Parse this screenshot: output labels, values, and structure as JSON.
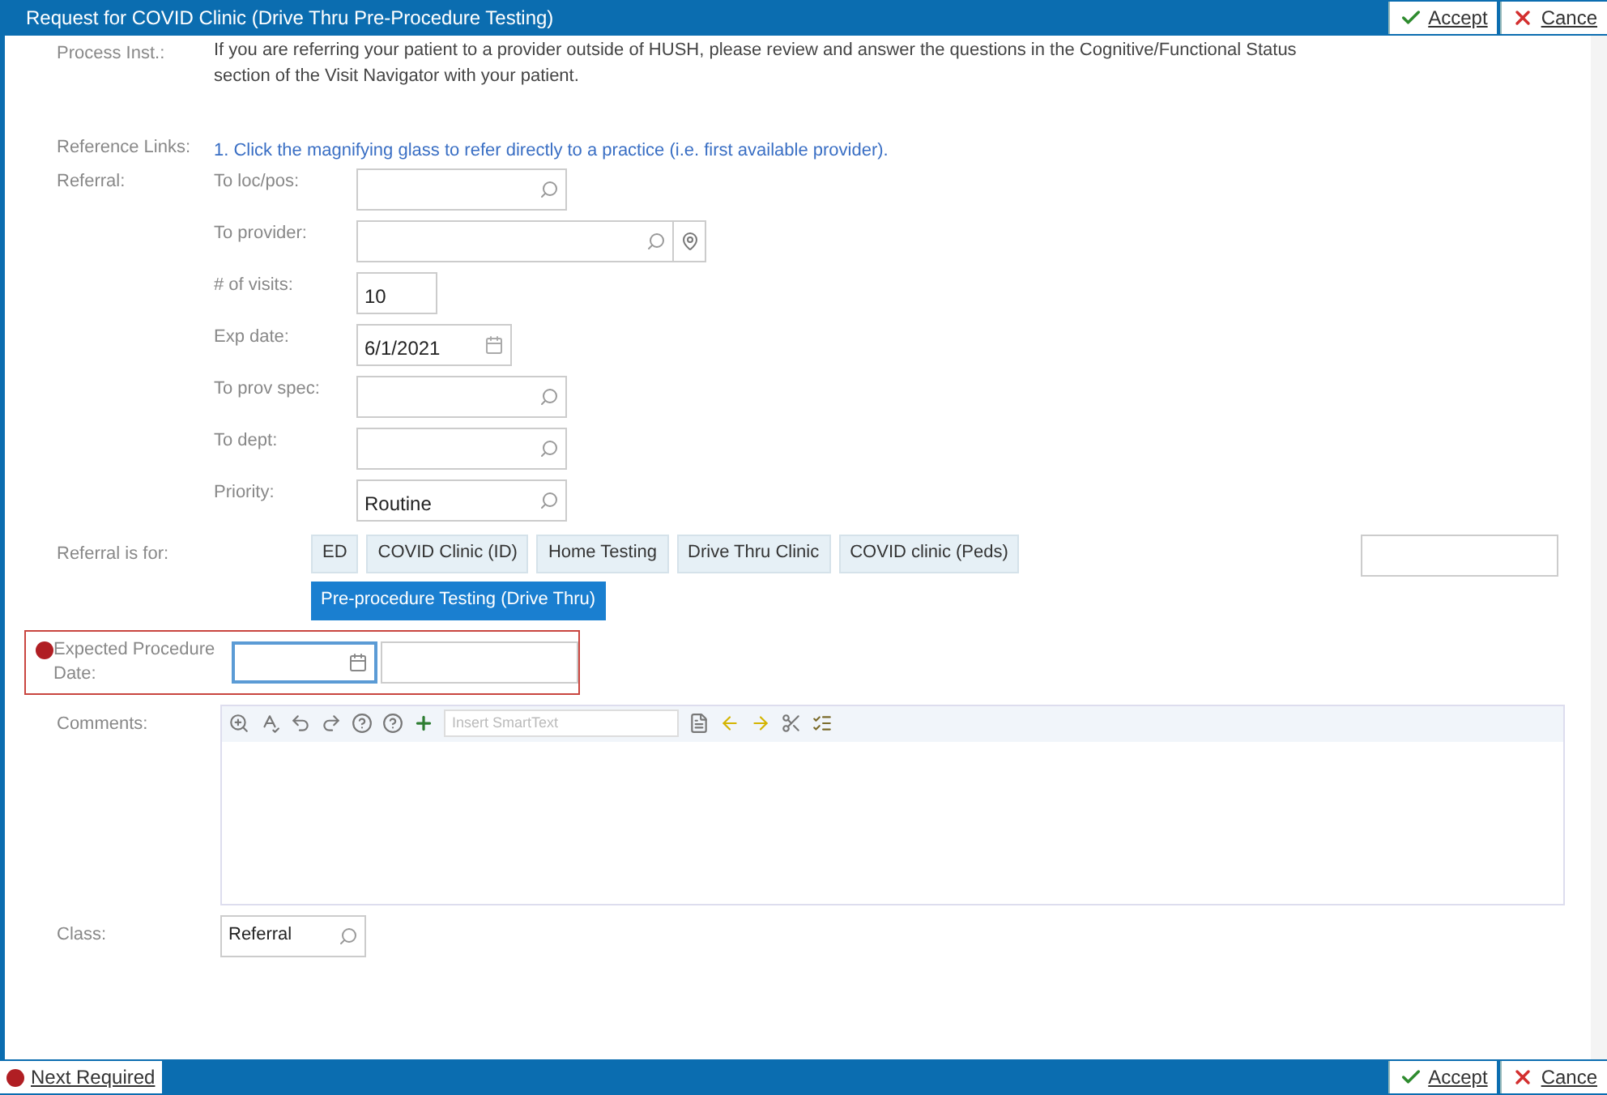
{
  "title": "Request for COVID Clinic (Drive Thru Pre-Procedure Testing)",
  "header_buttons": [
    {
      "kind": "accept",
      "label": "Accept"
    },
    {
      "kind": "cancel",
      "label": "Cance"
    }
  ],
  "process_inst": {
    "label": "Process Inst.:",
    "lines": [
      "If you are referring your patient to a provider outside of HUSH, please review and answer the questions in the Cognitive/Functional Status",
      "section of the Visit Navigator with your patient."
    ]
  },
  "reference_links": {
    "label": "Reference Links:",
    "link": "1. Click the magnifying glass to refer directly to a practice (i.e. first available provider)."
  },
  "referral": {
    "label": "Referral:",
    "fields": [
      {
        "label": "To loc/pos:",
        "kind": "lookup"
      },
      {
        "label": "To provider:",
        "kind": "lookup_pin"
      },
      {
        "label": "# of visits:",
        "kind": "text",
        "value": "10"
      },
      {
        "label": "Exp date:",
        "kind": "date",
        "value": "6/1/2021"
      },
      {
        "label": "To prov spec:",
        "kind": "lookup"
      },
      {
        "label": "To dept:",
        "kind": "lookup"
      },
      {
        "label": "Priority:",
        "kind": "lookup",
        "value": "Routine"
      }
    ]
  },
  "referral_is_for": {
    "label": "Referral is for:",
    "options": [
      {
        "label": "ED",
        "selected": false
      },
      {
        "label": "COVID Clinic (ID)",
        "selected": false
      },
      {
        "label": "Home Testing",
        "selected": false
      },
      {
        "label": "Drive Thru Clinic",
        "selected": false
      },
      {
        "label": "COVID clinic (Peds)",
        "selected": false
      },
      {
        "label": "Pre-procedure Testing (Drive Thru)",
        "selected": true
      }
    ]
  },
  "expected_procedure_date": {
    "label": "Expected Procedure Date:",
    "required": true
  },
  "comments": {
    "label": "Comments:",
    "smarttext_placeholder": "Insert SmartText"
  },
  "class": {
    "label": "Class:",
    "value": "Referral"
  },
  "footer": {
    "next_required": "Next Required",
    "buttons": [
      {
        "kind": "accept",
        "label": "Accept"
      },
      {
        "kind": "cancel",
        "label": "Cance"
      }
    ]
  }
}
